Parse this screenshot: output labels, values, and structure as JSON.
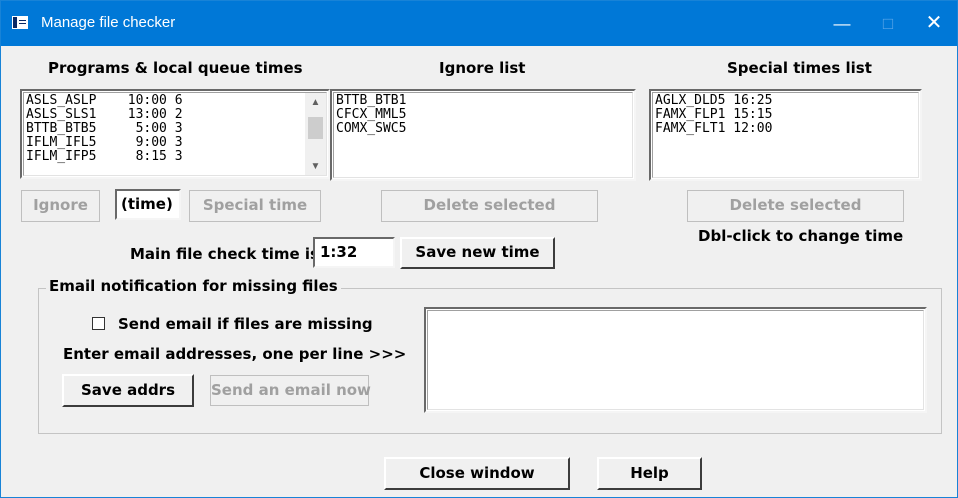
{
  "window": {
    "title": "Manage file checker",
    "controls": {
      "minimize": "—",
      "maximize": "□",
      "close": "✕"
    }
  },
  "programs": {
    "heading": "Programs & local queue times",
    "rows": [
      "ASLS_ASLP    10:00 6",
      "ASLS_SLS1    13:00 2",
      "BTTB_BTB5     5:00 3",
      "IFLM_IFL5     9:00 3",
      "IFLM_IFP5     8:15 3"
    ],
    "ignore_button": "Ignore",
    "time_field_value": "(time)",
    "special_time_button": "Special time"
  },
  "ignore_list": {
    "heading": "Ignore list",
    "rows": [
      "BTTB_BTB1",
      "CFCX_MML5",
      "COMX_SWC5"
    ],
    "delete_button": "Delete selected"
  },
  "special_times": {
    "heading": "Special times list",
    "rows": [
      "AGLX_DLD5 16:25",
      "FAMX_FLP1 15:15",
      "FAMX_FLT1 12:00"
    ],
    "delete_button": "Delete selected",
    "hint": "Dbl-click to change time"
  },
  "main_check": {
    "label": "Main file check time is",
    "value": "1:32",
    "save_button": "Save new time"
  },
  "email": {
    "group_title": "Email notification for missing files",
    "checkbox_label": "Send email if files are missing",
    "checkbox_checked": false,
    "instructions": "Enter email addresses, one per line >>>",
    "save_button": "Save addrs",
    "send_button": "Send an email now",
    "addresses_value": ""
  },
  "footer": {
    "close_button": "Close window",
    "help_button": "Help"
  }
}
